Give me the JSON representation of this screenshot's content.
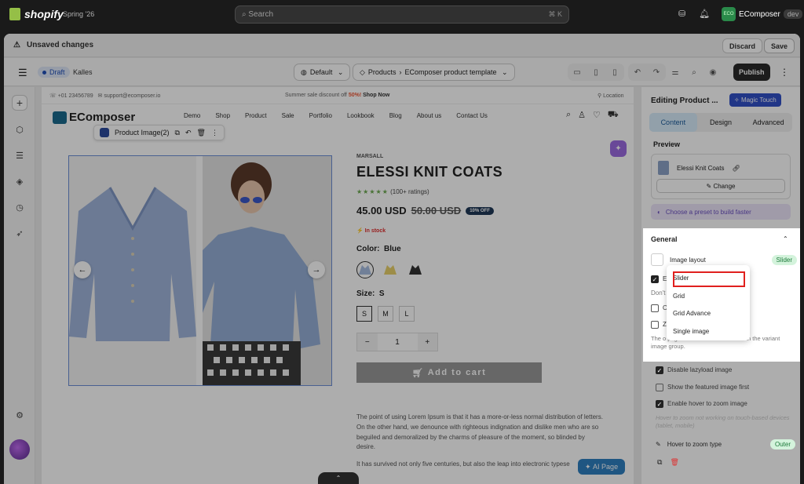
{
  "topbar": {
    "app": "shopify",
    "season": "Spring '26",
    "search_placeholder": "Search",
    "search_shortcut": "⌘ K",
    "store_initials": "ECO",
    "store_name": "EComposer",
    "store_env": "dev"
  },
  "notice": {
    "text": "Unsaved changes",
    "discard": "Discard",
    "save": "Save"
  },
  "toolbar": {
    "status": "Draft",
    "theme": "Kalles",
    "view": "Default",
    "breadcrumb_root": "Products",
    "breadcrumb_page": "EComposer product template",
    "publish": "Publish"
  },
  "store": {
    "phone": "+01 23456789",
    "email": "support@ecomposer.io",
    "promo": "Summer sale discount off",
    "promo_pct": "50%!",
    "promo_cta": "Shop Now",
    "location": "Location",
    "brand": "EComposer",
    "nav": [
      "Demo",
      "Shop",
      "Product",
      "Sale",
      "Portfolio",
      "Lookbook",
      "Blog",
      "About us",
      "Contact Us"
    ]
  },
  "element": {
    "label": "Product Image(2)"
  },
  "product": {
    "vendor": "MARSALL",
    "title": "ELESSI KNIT COATS",
    "stars": "★★★★★",
    "ratings": "(100+ ratings)",
    "price": "45.00 USD",
    "compare": "50.00 USD",
    "badge": "10% OFF",
    "stock": "In stock",
    "color_label": "Color:",
    "color_value": "Blue",
    "size_label": "Size:",
    "size_value": "S",
    "sizes": [
      "S",
      "M",
      "L"
    ],
    "qty": "1",
    "minus": "−",
    "plus": "+",
    "add_to_cart": "Add to cart",
    "description": "The point of using Lorem Ipsum is that it has a more-or-less normal distribution of letters. On the other hand, we denounce with righteous indignation and dislike men who are so beguiled and demoralized by the charms of pleasure of the moment, so blinded by desire.",
    "desc2": "It has survived not only five centuries, but also the leap into electronic typese",
    "ai": "AI Page"
  },
  "panel": {
    "title": "Editing Product ...",
    "magic": "Magic Touch",
    "tabs": [
      "Content",
      "Design",
      "Advanced"
    ],
    "preview_label": "Preview",
    "preview_item": "Elessi Knit Coats",
    "change": "Change",
    "preset": "Choose a preset to build faster",
    "general": "General",
    "image_layout": "Image layout",
    "layout_value": "Slider",
    "row1": "E",
    "row1_note": "Don't",
    "row2": "O",
    "row3": "Z",
    "general_note": "The o                              page and does not function with the variant image group.",
    "lazyload": "Disable lazyload image",
    "featured": "Show the featured image first",
    "hover_zoom": "Enable hover to zoom image",
    "hover_note": "Hover to zoom not working on touch-based devices (tablet, mobile)",
    "zoom_type": "Hover to zoom type",
    "zoom_value": "Outer"
  },
  "dropdown": {
    "options": [
      "Slider",
      "Grid",
      "Grid Advance",
      "Single image"
    ],
    "selected": "Slider"
  },
  "colors": {
    "accent": "#3250c8",
    "publish": "#2a2a2a",
    "highlight": "#e0201e",
    "swatch_blue": "#a7bde0",
    "swatch_yellow": "#e8d06a",
    "swatch_black": "#333333"
  }
}
